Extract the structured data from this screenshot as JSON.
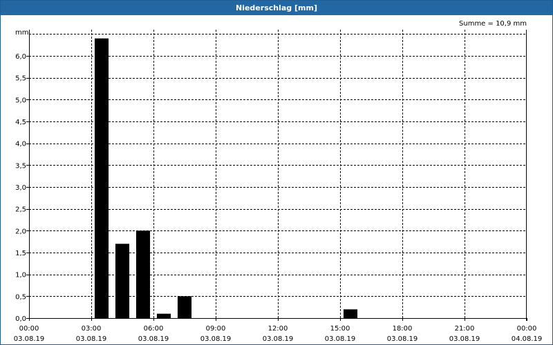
{
  "window": {
    "title": "Niederschlag [mm]"
  },
  "chart_data": {
    "type": "bar",
    "title": "Niederschlag [mm]",
    "ylabel": "mm",
    "annotation": "Summe = 10,9 mm",
    "ylim": [
      0,
      6.6
    ],
    "yticks": [
      "0,0",
      "0,5",
      "1,0",
      "1,5",
      "2,0",
      "2,5",
      "3,0",
      "3,5",
      "4,0",
      "4,5",
      "5,0",
      "5,5",
      "6,0"
    ],
    "xticks": [
      {
        "time": "00:00",
        "date": "03.08.19"
      },
      {
        "time": "03:00",
        "date": "03.08.19"
      },
      {
        "time": "06:00",
        "date": "03.08.19"
      },
      {
        "time": "09:00",
        "date": "03.08.19"
      },
      {
        "time": "12:00",
        "date": "03.08.19"
      },
      {
        "time": "15:00",
        "date": "03.08.19"
      },
      {
        "time": "18:00",
        "date": "03.08.19"
      },
      {
        "time": "21:00",
        "date": "03.08.19"
      },
      {
        "time": "00:00",
        "date": "04.08.19"
      }
    ],
    "x_range": [
      "03.08.19 00:00",
      "04.08.19 00:00"
    ],
    "bars": [
      {
        "start": "03.08.19 03:00",
        "end": "03.08.19 04:00",
        "value": 6.4
      },
      {
        "start": "03.08.19 04:00",
        "end": "03.08.19 05:00",
        "value": 1.7
      },
      {
        "start": "03.08.19 05:00",
        "end": "03.08.19 06:00",
        "value": 2.0
      },
      {
        "start": "03.08.19 06:00",
        "end": "03.08.19 07:00",
        "value": 0.1
      },
      {
        "start": "03.08.19 07:00",
        "end": "03.08.19 08:00",
        "value": 0.5
      },
      {
        "start": "03.08.19 15:00",
        "end": "03.08.19 16:00",
        "value": 0.2
      }
    ],
    "grid": true,
    "bar_color": "#000000"
  }
}
